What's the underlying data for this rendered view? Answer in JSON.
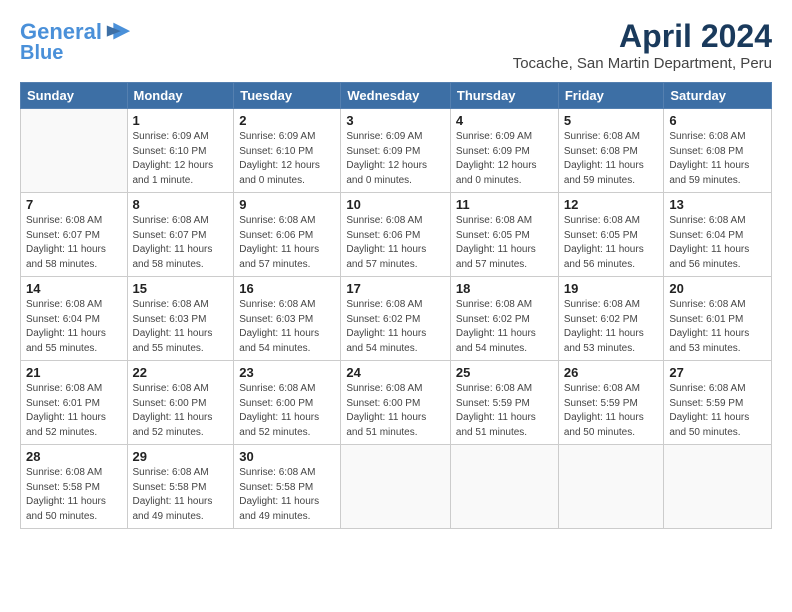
{
  "header": {
    "logo_line1": "General",
    "logo_line2": "Blue",
    "title": "April 2024",
    "subtitle": "Tocache, San Martin Department, Peru"
  },
  "days_of_week": [
    "Sunday",
    "Monday",
    "Tuesday",
    "Wednesday",
    "Thursday",
    "Friday",
    "Saturday"
  ],
  "weeks": [
    [
      {
        "day": "",
        "info": ""
      },
      {
        "day": "1",
        "info": "Sunrise: 6:09 AM\nSunset: 6:10 PM\nDaylight: 12 hours\nand 1 minute."
      },
      {
        "day": "2",
        "info": "Sunrise: 6:09 AM\nSunset: 6:10 PM\nDaylight: 12 hours\nand 0 minutes."
      },
      {
        "day": "3",
        "info": "Sunrise: 6:09 AM\nSunset: 6:09 PM\nDaylight: 12 hours\nand 0 minutes."
      },
      {
        "day": "4",
        "info": "Sunrise: 6:09 AM\nSunset: 6:09 PM\nDaylight: 12 hours\nand 0 minutes."
      },
      {
        "day": "5",
        "info": "Sunrise: 6:08 AM\nSunset: 6:08 PM\nDaylight: 11 hours\nand 59 minutes."
      },
      {
        "day": "6",
        "info": "Sunrise: 6:08 AM\nSunset: 6:08 PM\nDaylight: 11 hours\nand 59 minutes."
      }
    ],
    [
      {
        "day": "7",
        "info": "Sunrise: 6:08 AM\nSunset: 6:07 PM\nDaylight: 11 hours\nand 58 minutes."
      },
      {
        "day": "8",
        "info": "Sunrise: 6:08 AM\nSunset: 6:07 PM\nDaylight: 11 hours\nand 58 minutes."
      },
      {
        "day": "9",
        "info": "Sunrise: 6:08 AM\nSunset: 6:06 PM\nDaylight: 11 hours\nand 57 minutes."
      },
      {
        "day": "10",
        "info": "Sunrise: 6:08 AM\nSunset: 6:06 PM\nDaylight: 11 hours\nand 57 minutes."
      },
      {
        "day": "11",
        "info": "Sunrise: 6:08 AM\nSunset: 6:05 PM\nDaylight: 11 hours\nand 57 minutes."
      },
      {
        "day": "12",
        "info": "Sunrise: 6:08 AM\nSunset: 6:05 PM\nDaylight: 11 hours\nand 56 minutes."
      },
      {
        "day": "13",
        "info": "Sunrise: 6:08 AM\nSunset: 6:04 PM\nDaylight: 11 hours\nand 56 minutes."
      }
    ],
    [
      {
        "day": "14",
        "info": "Sunrise: 6:08 AM\nSunset: 6:04 PM\nDaylight: 11 hours\nand 55 minutes."
      },
      {
        "day": "15",
        "info": "Sunrise: 6:08 AM\nSunset: 6:03 PM\nDaylight: 11 hours\nand 55 minutes."
      },
      {
        "day": "16",
        "info": "Sunrise: 6:08 AM\nSunset: 6:03 PM\nDaylight: 11 hours\nand 54 minutes."
      },
      {
        "day": "17",
        "info": "Sunrise: 6:08 AM\nSunset: 6:02 PM\nDaylight: 11 hours\nand 54 minutes."
      },
      {
        "day": "18",
        "info": "Sunrise: 6:08 AM\nSunset: 6:02 PM\nDaylight: 11 hours\nand 54 minutes."
      },
      {
        "day": "19",
        "info": "Sunrise: 6:08 AM\nSunset: 6:02 PM\nDaylight: 11 hours\nand 53 minutes."
      },
      {
        "day": "20",
        "info": "Sunrise: 6:08 AM\nSunset: 6:01 PM\nDaylight: 11 hours\nand 53 minutes."
      }
    ],
    [
      {
        "day": "21",
        "info": "Sunrise: 6:08 AM\nSunset: 6:01 PM\nDaylight: 11 hours\nand 52 minutes."
      },
      {
        "day": "22",
        "info": "Sunrise: 6:08 AM\nSunset: 6:00 PM\nDaylight: 11 hours\nand 52 minutes."
      },
      {
        "day": "23",
        "info": "Sunrise: 6:08 AM\nSunset: 6:00 PM\nDaylight: 11 hours\nand 52 minutes."
      },
      {
        "day": "24",
        "info": "Sunrise: 6:08 AM\nSunset: 6:00 PM\nDaylight: 11 hours\nand 51 minutes."
      },
      {
        "day": "25",
        "info": "Sunrise: 6:08 AM\nSunset: 5:59 PM\nDaylight: 11 hours\nand 51 minutes."
      },
      {
        "day": "26",
        "info": "Sunrise: 6:08 AM\nSunset: 5:59 PM\nDaylight: 11 hours\nand 50 minutes."
      },
      {
        "day": "27",
        "info": "Sunrise: 6:08 AM\nSunset: 5:59 PM\nDaylight: 11 hours\nand 50 minutes."
      }
    ],
    [
      {
        "day": "28",
        "info": "Sunrise: 6:08 AM\nSunset: 5:58 PM\nDaylight: 11 hours\nand 50 minutes."
      },
      {
        "day": "29",
        "info": "Sunrise: 6:08 AM\nSunset: 5:58 PM\nDaylight: 11 hours\nand 49 minutes."
      },
      {
        "day": "30",
        "info": "Sunrise: 6:08 AM\nSunset: 5:58 PM\nDaylight: 11 hours\nand 49 minutes."
      },
      {
        "day": "",
        "info": ""
      },
      {
        "day": "",
        "info": ""
      },
      {
        "day": "",
        "info": ""
      },
      {
        "day": "",
        "info": ""
      }
    ]
  ]
}
